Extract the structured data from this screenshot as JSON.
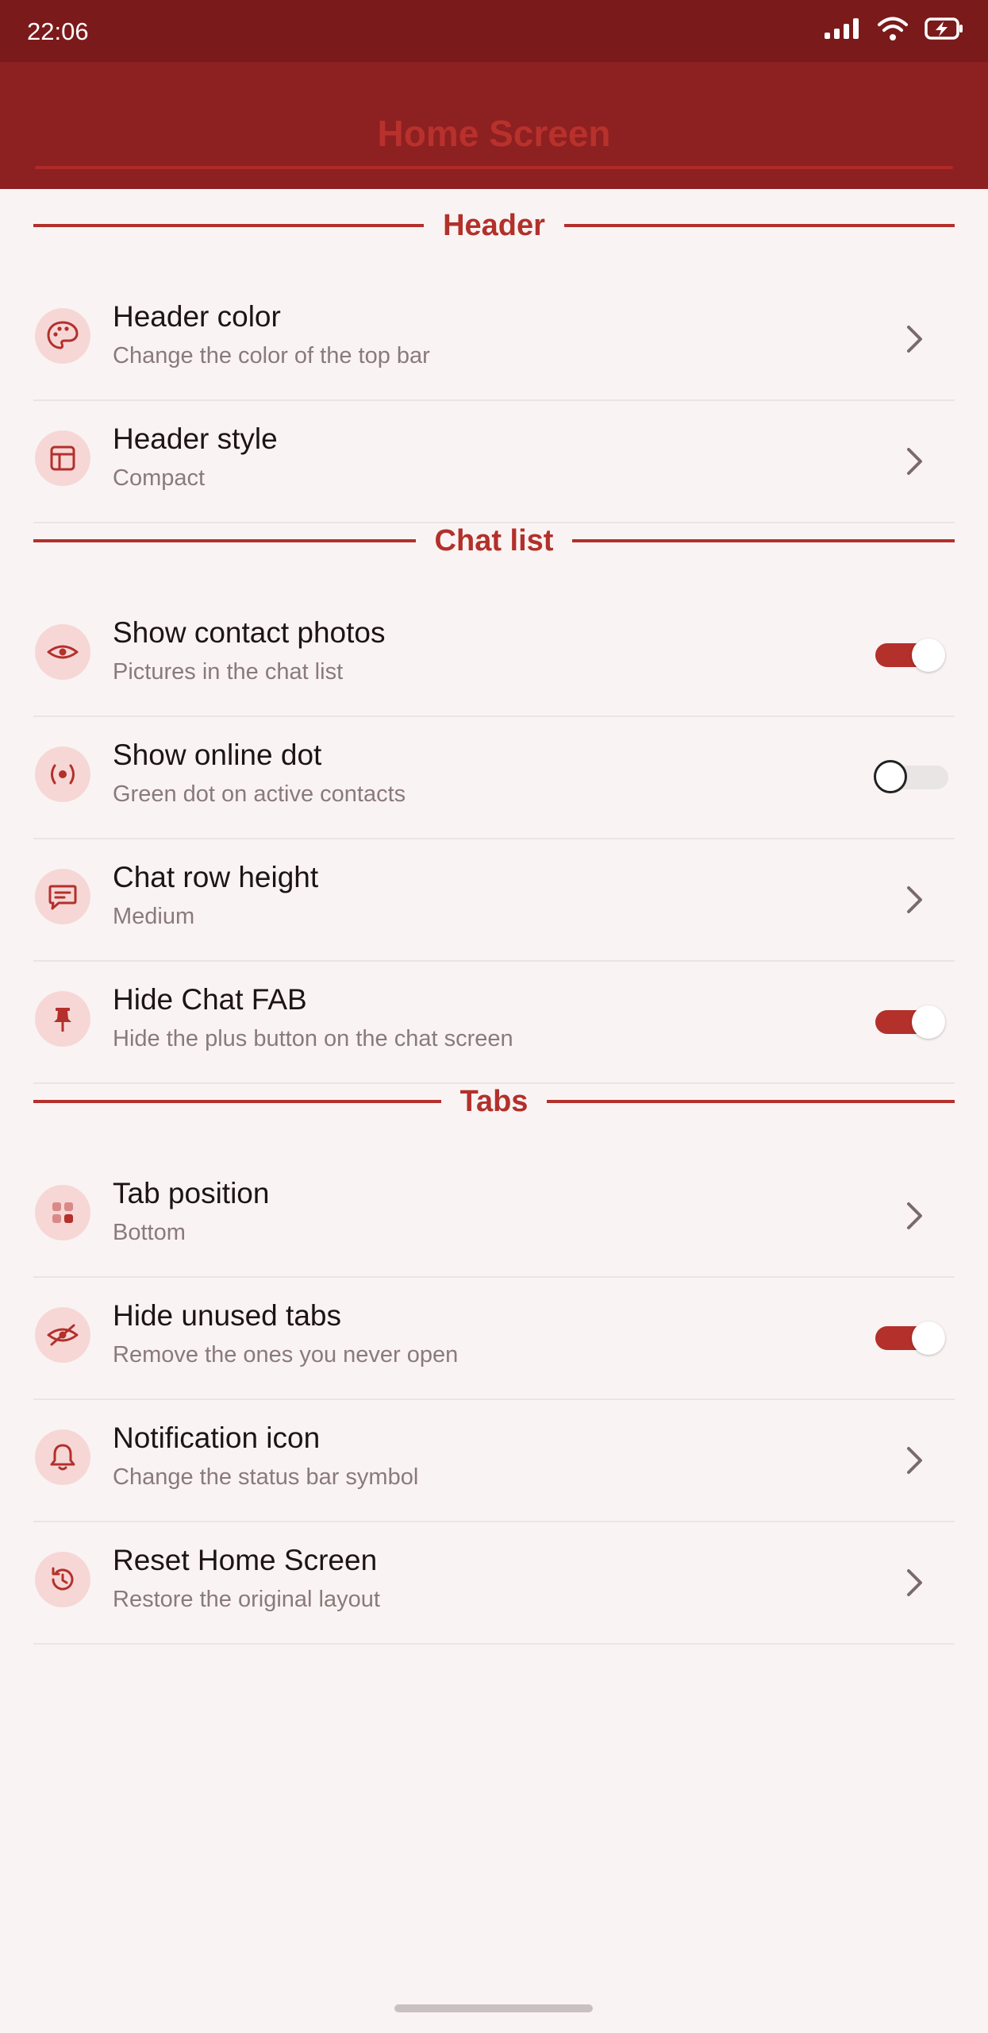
{
  "status_bar": {
    "time": "22:06",
    "icons": [
      "signal-icon",
      "wifi-icon",
      "battery-charging-icon"
    ]
  },
  "app_bar": {
    "title": "Home Screen"
  },
  "colors": {
    "status_bar": "#7b1a1a",
    "app_bar": "#8d2020",
    "accent": "#b3302b",
    "icon_circle": "#f6d7d6",
    "background": "#f9f4f3"
  },
  "sections": [
    {
      "label": "Header",
      "items": [
        {
          "title": "Header color",
          "subtitle": "Change the color of the top bar",
          "icon": "palette-icon",
          "control": "chevron"
        },
        {
          "title": "Header style",
          "subtitle": "Compact",
          "icon": "layout-icon",
          "control": "chevron"
        }
      ]
    },
    {
      "label": "Chat list",
      "items": [
        {
          "title": "Show contact photos",
          "subtitle": "Pictures in the chat list",
          "icon": "eye-icon",
          "control": "toggle",
          "checked": true
        },
        {
          "title": "Show online dot",
          "subtitle": "Green dot on active contacts",
          "icon": "online-dot-icon",
          "control": "toggle",
          "checked": false
        },
        {
          "title": "Chat row height",
          "subtitle": "Medium",
          "icon": "chat-bubble-icon",
          "control": "chevron"
        },
        {
          "title": "Hide Chat FAB",
          "subtitle": "Hide the plus button on the chat screen",
          "icon": "pin-icon",
          "control": "toggle",
          "checked": true
        }
      ]
    },
    {
      "label": "Tabs",
      "items": [
        {
          "title": "Tab position",
          "subtitle": "Bottom",
          "icon": "grid-icon",
          "control": "chevron"
        },
        {
          "title": "Hide unused tabs",
          "subtitle": "Remove the ones you never open",
          "icon": "eye-off-icon",
          "control": "toggle",
          "checked": true
        },
        {
          "title": "Notification icon",
          "subtitle": "Change the status bar symbol",
          "icon": "bell-icon",
          "control": "chevron"
        },
        {
          "title": "Reset Home Screen",
          "subtitle": "Restore the original layout",
          "icon": "reset-icon",
          "control": "chevron"
        }
      ]
    }
  ]
}
